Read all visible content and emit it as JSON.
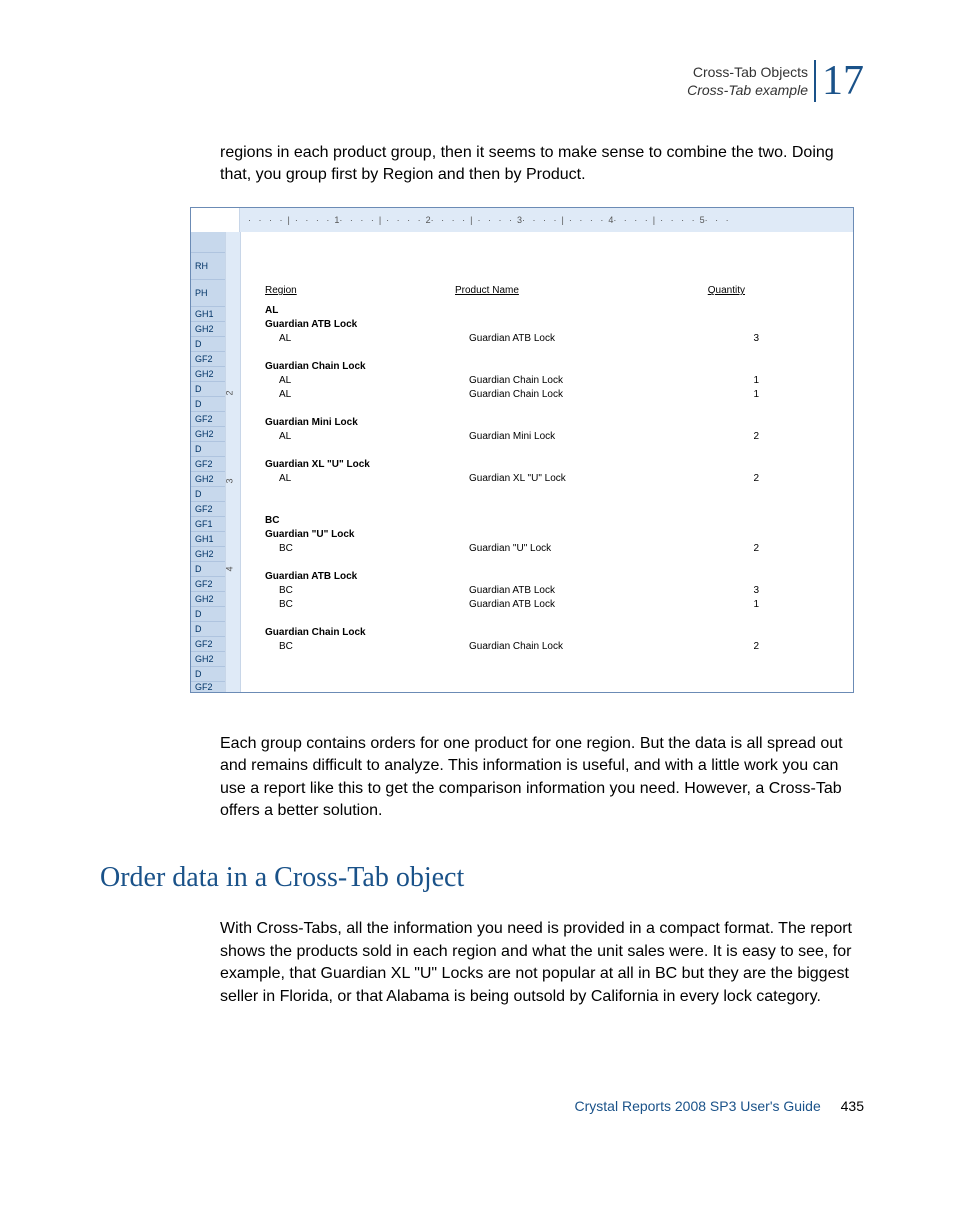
{
  "header": {
    "line1": "Cross-Tab Objects",
    "line2": "Cross-Tab example",
    "chapter": "17"
  },
  "para1": "regions in each product group, then it seems to make sense to combine the two. Doing that, you group first by Region and then by Product.",
  "screenshot": {
    "ruler": [
      "1",
      "2",
      "3",
      "4",
      "5"
    ],
    "vruler": [
      "2",
      "3",
      "4"
    ],
    "sections": [
      "RH",
      "PH",
      "GH1",
      "GH2",
      "D",
      "GF2",
      "GH2",
      "D",
      "D",
      "GF2",
      "GH2",
      "D",
      "GF2",
      "GH2",
      "D",
      "GF2",
      "GF1",
      "GH1",
      "GH2",
      "D",
      "GF2",
      "GH2",
      "D",
      "D",
      "GF2",
      "GH2",
      "D",
      "GF2"
    ],
    "columns": {
      "region": "Region",
      "product": "Product Name",
      "qty": "Quantity"
    },
    "rows": [
      {
        "type": "gh1",
        "region": "AL"
      },
      {
        "type": "gh2",
        "product": "Guardian ATB Lock"
      },
      {
        "type": "d",
        "region": "AL",
        "product": "Guardian ATB Lock",
        "qty": "3"
      },
      {
        "type": "gf2"
      },
      {
        "type": "gh2",
        "product": "Guardian Chain Lock"
      },
      {
        "type": "d",
        "region": "AL",
        "product": "Guardian Chain Lock",
        "qty": "1"
      },
      {
        "type": "d",
        "region": "AL",
        "product": "Guardian Chain Lock",
        "qty": "1"
      },
      {
        "type": "gf2"
      },
      {
        "type": "gh2",
        "product": "Guardian Mini Lock"
      },
      {
        "type": "d",
        "region": "AL",
        "product": "Guardian Mini Lock",
        "qty": "2"
      },
      {
        "type": "gf2"
      },
      {
        "type": "gh2",
        "product": "Guardian XL \"U\" Lock"
      },
      {
        "type": "d",
        "region": "AL",
        "product": "Guardian XL \"U\" Lock",
        "qty": "2"
      },
      {
        "type": "gf2"
      },
      {
        "type": "gf1"
      },
      {
        "type": "gh1",
        "region": "BC"
      },
      {
        "type": "gh2",
        "product": "Guardian \"U\" Lock"
      },
      {
        "type": "d",
        "region": "BC",
        "product": "Guardian \"U\" Lock",
        "qty": "2"
      },
      {
        "type": "gf2"
      },
      {
        "type": "gh2",
        "product": "Guardian ATB Lock"
      },
      {
        "type": "d",
        "region": "BC",
        "product": "Guardian ATB Lock",
        "qty": "3"
      },
      {
        "type": "d",
        "region": "BC",
        "product": "Guardian ATB Lock",
        "qty": "1"
      },
      {
        "type": "gf2"
      },
      {
        "type": "gh2",
        "product": "Guardian Chain Lock"
      },
      {
        "type": "d",
        "region": "BC",
        "product": "Guardian Chain Lock",
        "qty": "2"
      },
      {
        "type": "gf2cut"
      }
    ]
  },
  "para2": "Each group contains orders for one product for one region. But the data is all spread out and remains difficult to analyze. This information is useful, and with a little work you can use a report like this to get the comparison information you need. However, a Cross-Tab offers a better solution.",
  "h2": "Order data in a Cross-Tab object",
  "para3": "With Cross-Tabs, all the information you need is provided in a compact format. The report shows the products sold in each region and what the unit sales were. It is easy to see, for example, that Guardian XL \"U\" Locks are not popular at all in BC but they are the biggest seller in Florida, or that Alabama is being outsold by California in every lock category.",
  "footer": {
    "guide": "Crystal Reports 2008 SP3 User's Guide",
    "page": "435"
  }
}
